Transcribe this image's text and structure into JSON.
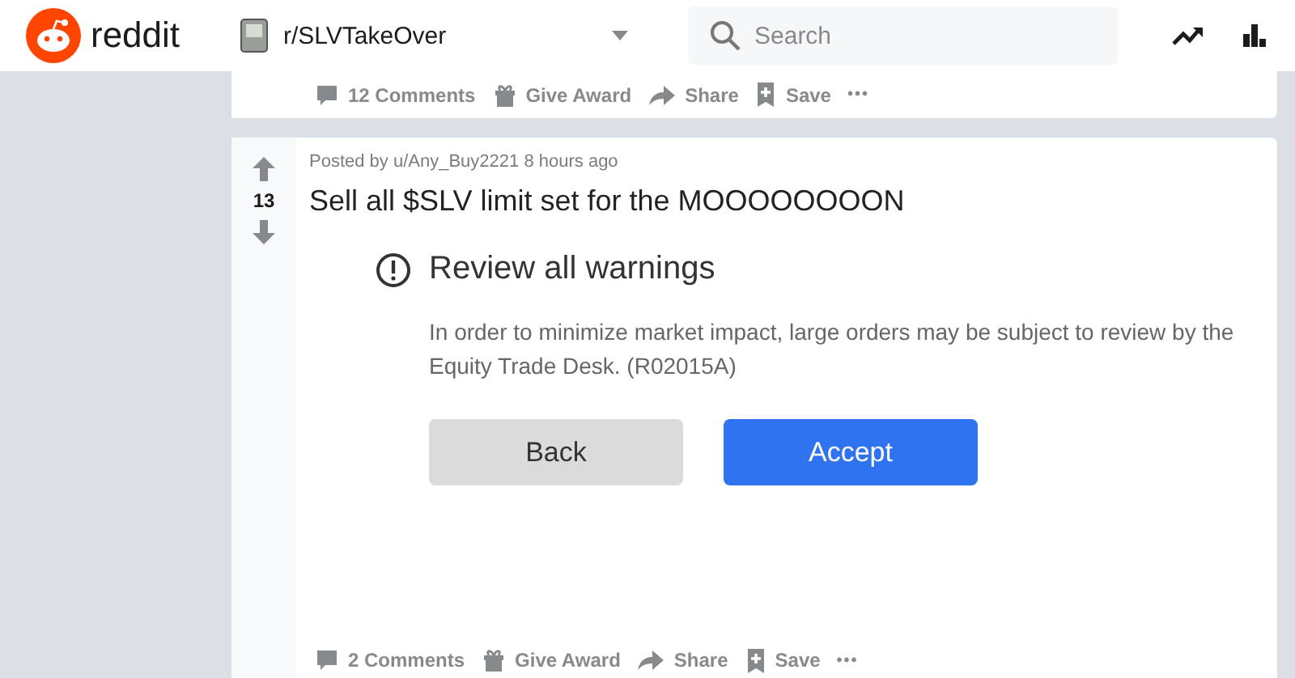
{
  "header": {
    "logo_text": "reddit",
    "community": "r/SLVTakeOver",
    "search": {
      "placeholder": "Search"
    }
  },
  "previous_post": {
    "actions": [
      {
        "kind": "comments",
        "label": "12 Comments"
      },
      {
        "kind": "award",
        "label": "Give Award"
      },
      {
        "kind": "share",
        "label": "Share"
      },
      {
        "kind": "save",
        "label": "Save"
      },
      {
        "kind": "more",
        "label": "•••"
      }
    ]
  },
  "post": {
    "score": "13",
    "meta": "Posted by u/Any_Buy2221 8 hours ago",
    "title": "Sell all $SLV limit set for the MOOOOOOOON",
    "dialog": {
      "title": "Review all warnings",
      "body": "In order to minimize market impact, large orders may be subject to review by the Equity Trade Desk. (R02015A)",
      "buttons": [
        {
          "label": "Back",
          "kind": "secondary"
        },
        {
          "label": "Accept",
          "kind": "primary"
        }
      ]
    },
    "actions": [
      {
        "kind": "comments",
        "label": "2 Comments"
      },
      {
        "kind": "award",
        "label": "Give Award"
      },
      {
        "kind": "share",
        "label": "Share"
      },
      {
        "kind": "save",
        "label": "Save"
      },
      {
        "kind": "more",
        "label": "•••"
      }
    ]
  }
}
